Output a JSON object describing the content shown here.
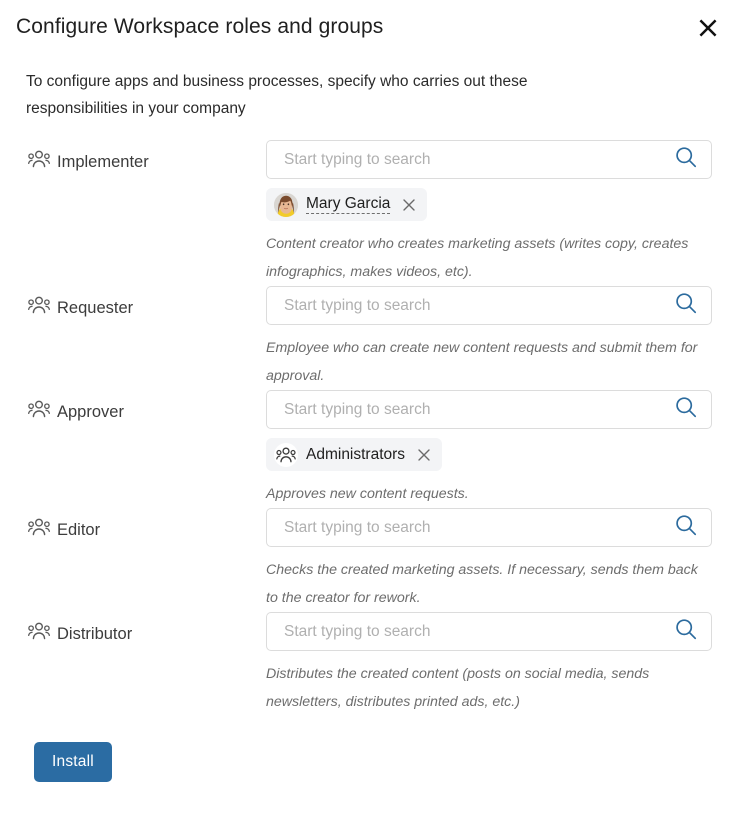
{
  "header": {
    "title": "Configure Workspace roles and groups",
    "close_icon": "close-icon"
  },
  "intro": {
    "text": "To configure apps and business processes, specify who carries out these responsibilities in your company"
  },
  "search": {
    "placeholder": "Start typing to search",
    "value": "",
    "icon": "search-icon",
    "icon_color": "#2c6b9e"
  },
  "roles": [
    {
      "key": "implementer",
      "label": "Implementer",
      "icon": "group-icon",
      "helper": "Content creator who creates marketing assets (writes copy, creates infographics, makes videos, etc).",
      "chips": [
        {
          "name": "Mary Garcia",
          "type": "user",
          "avatar": "user-photo-avatar",
          "linked": true,
          "remove_icon": "close-icon"
        }
      ]
    },
    {
      "key": "requester",
      "label": "Requester",
      "icon": "group-icon",
      "helper": "Employee who can create new content requests and submit them for approval.",
      "chips": []
    },
    {
      "key": "approver",
      "label": "Approver",
      "icon": "group-icon",
      "helper": "Approves new content requests.",
      "chips": [
        {
          "name": "Administrators",
          "type": "group",
          "avatar": "group-icon",
          "linked": false,
          "remove_icon": "close-icon"
        }
      ]
    },
    {
      "key": "editor",
      "label": "Editor",
      "icon": "group-icon",
      "helper": "Checks the created marketing assets. If necessary, sends them back to the creator for rework.",
      "chips": []
    },
    {
      "key": "distributor",
      "label": "Distributor",
      "icon": "group-icon",
      "helper": "Distributes the created content (posts on social media, sends newsletters, distributes printed ads, etc.)",
      "chips": []
    }
  ],
  "footer": {
    "install_label": "Install",
    "install_color": "#2b6ca3"
  }
}
